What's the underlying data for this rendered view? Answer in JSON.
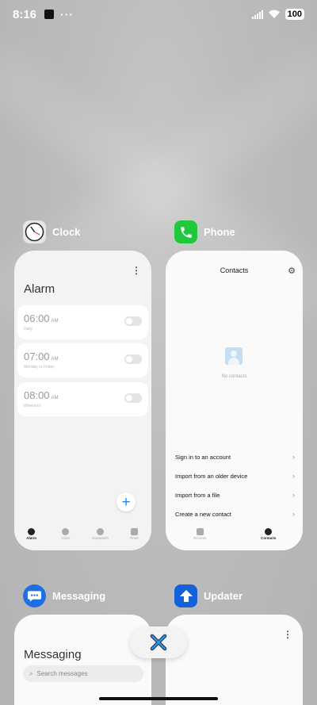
{
  "status_bar": {
    "time": "8:16",
    "battery": "100"
  },
  "apps": {
    "clock": {
      "label": "Clock",
      "title": "Alarm",
      "alarms": [
        {
          "time": "06:00",
          "ampm": "AM",
          "sub": "Daily"
        },
        {
          "time": "07:00",
          "ampm": "AM",
          "sub": "Monday to Friday"
        },
        {
          "time": "08:00",
          "ampm": "AM",
          "sub": "Weekend"
        }
      ],
      "tabs": [
        {
          "label": "Alarm",
          "active": true
        },
        {
          "label": "Clock",
          "active": false
        },
        {
          "label": "Stopwatch",
          "active": false
        },
        {
          "label": "Timer",
          "active": false
        }
      ]
    },
    "phone": {
      "label": "Phone",
      "title": "Contacts",
      "empty_text": "No contacts",
      "options": [
        "Sign in to an account",
        "Import from an older device",
        "Import from a file",
        "Create a new contact"
      ],
      "tabs": [
        {
          "label": "Recents",
          "active": false
        },
        {
          "label": "Contacts",
          "active": true
        }
      ]
    },
    "messaging": {
      "label": "Messaging",
      "title": "Messaging",
      "search_placeholder": "Search messages"
    },
    "updater": {
      "label": "Updater"
    }
  },
  "colors": {
    "accent": "#1e88e5",
    "phone_icon": "#20c83c",
    "messaging_icon": "#1e6fe0",
    "updater_icon": "#1561d9"
  }
}
